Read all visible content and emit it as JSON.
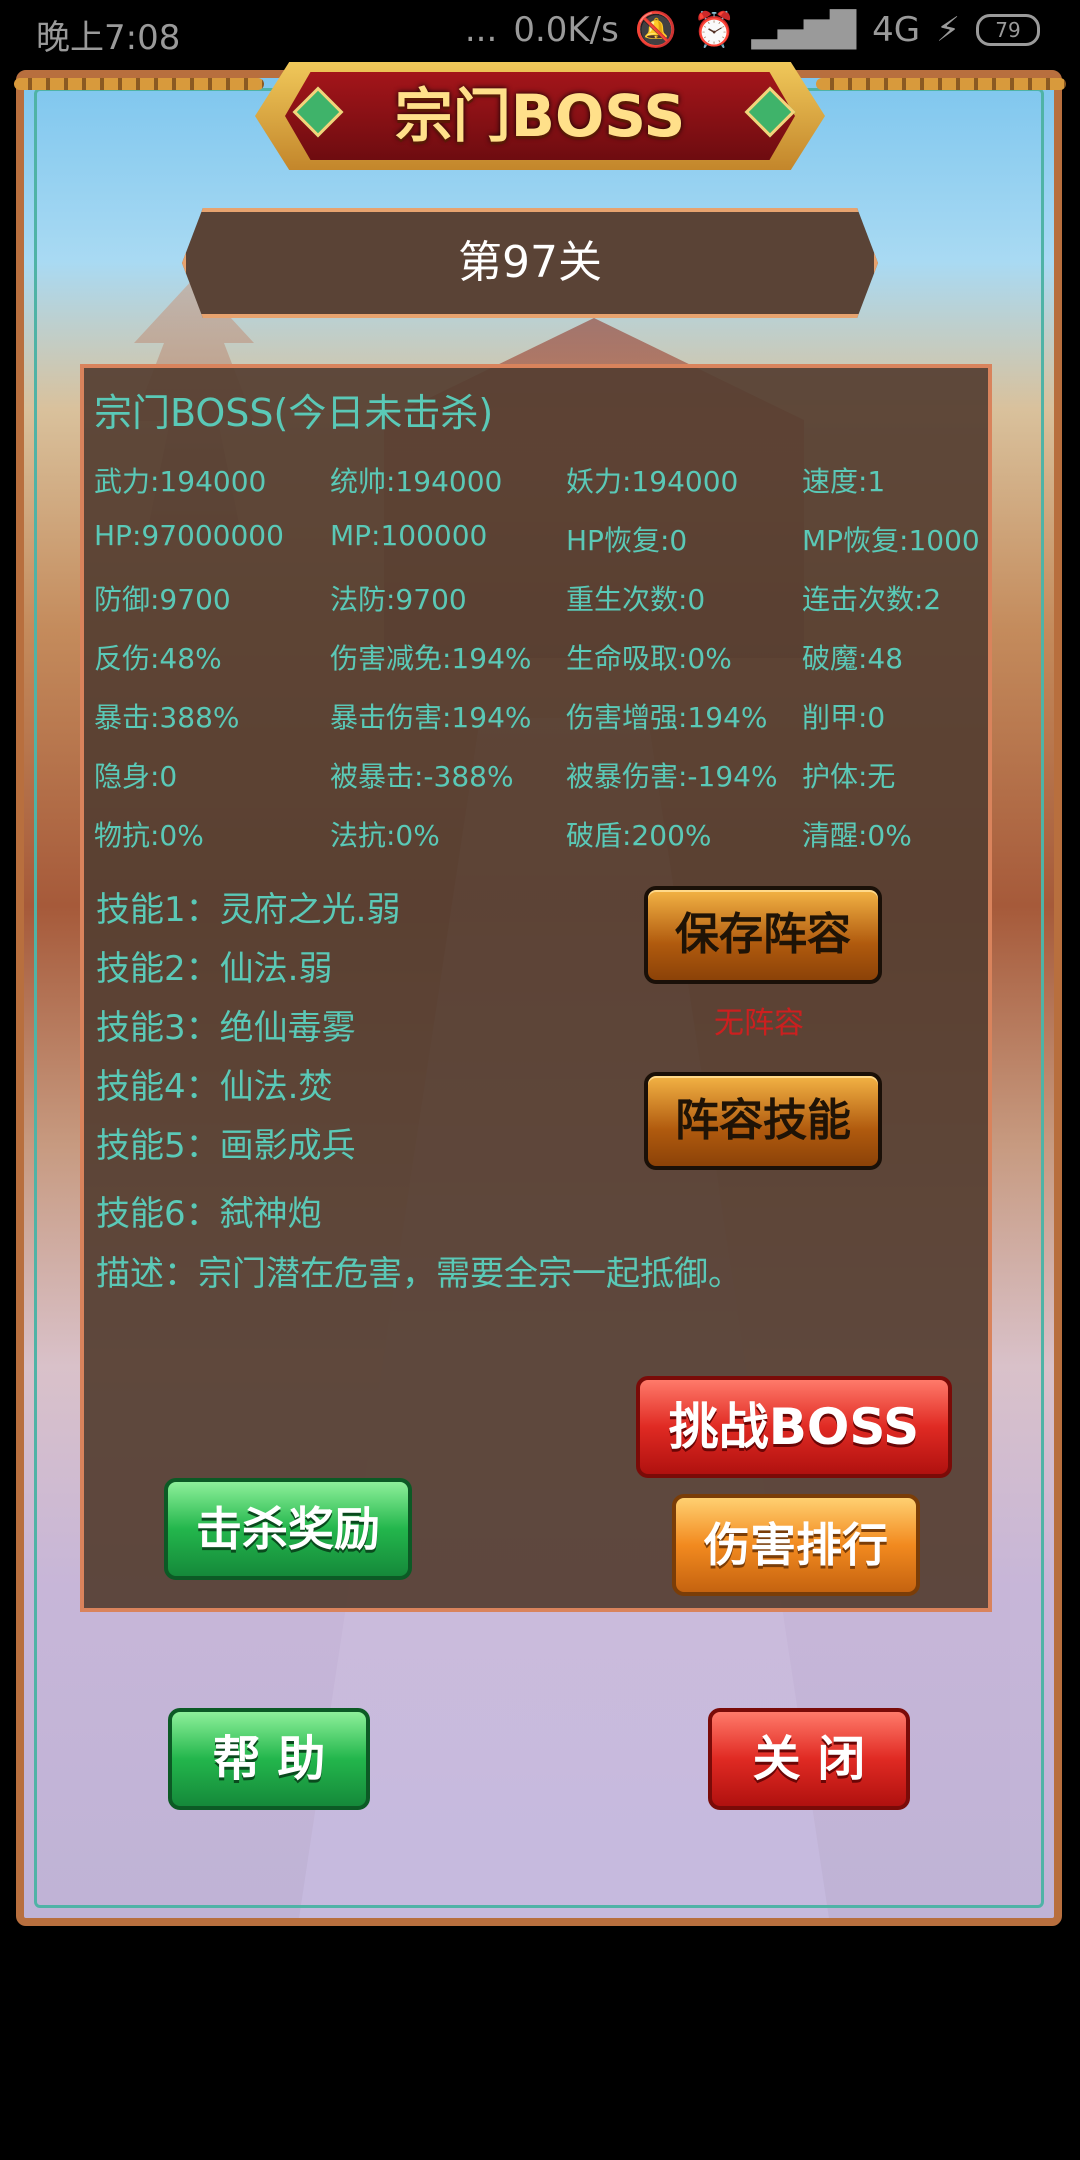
{
  "status_bar": {
    "time": "晚上7:08",
    "dots": "...",
    "network_speed": "0.0K/s",
    "signal": "4G",
    "battery": "79"
  },
  "header": {
    "title": "宗门BOSS"
  },
  "level": {
    "label": "第97关"
  },
  "panel": {
    "title": "宗门BOSS(今日未击杀)",
    "stats": [
      [
        "武力:194000",
        "统帅:194000",
        "妖力:194000",
        "速度:1"
      ],
      [
        "HP:97000000",
        "MP:100000",
        "HP恢复:0",
        "MP恢复:1000"
      ],
      [
        "防御:9700",
        "法防:9700",
        "重生次数:0",
        "连击次数:2"
      ],
      [
        "反伤:48%",
        "伤害减免:194%",
        "生命吸取:0%",
        "破魔:48"
      ],
      [
        "暴击:388%",
        "暴击伤害:194%",
        "伤害增强:194%",
        "削甲:0"
      ],
      [
        "隐身:0",
        "被暴击:-388%",
        "被暴伤害:-194%",
        "护体:无"
      ],
      [
        "物抗:0%",
        "法抗:0%",
        "破盾:200%",
        "清醒:0%"
      ]
    ],
    "skills": [
      "技能1：灵府之光.弱",
      "技能2：仙法.弱",
      "技能3：绝仙毒雾",
      "技能4：仙法.焚",
      "技能5：画影成兵",
      "技能6：弑神炮"
    ],
    "description": "描述：宗门潜在危害，需要全宗一起抵御。",
    "no_lineup": "无阵容"
  },
  "buttons": {
    "save_lineup": "保存阵容",
    "lineup_skill": "阵容技能",
    "challenge": "挑战BOSS",
    "kill_reward": "击杀奖励",
    "damage_rank": "伤害排行",
    "help": "帮 助",
    "close": "关 闭"
  }
}
